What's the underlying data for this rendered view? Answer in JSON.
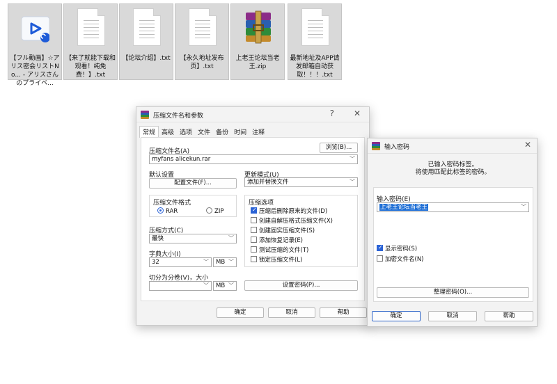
{
  "desktop": {
    "files": [
      {
        "name": "【フル動画】☆アリス密会リストNo... - アリスさんのプライベ...",
        "icon": "video-shortcut-icon"
      },
      {
        "name": "【来了就能下载和观看！纯免费！】.txt",
        "icon": "text-file-icon"
      },
      {
        "name": "【论坛介绍】.txt",
        "icon": "text-file-icon"
      },
      {
        "name": "【永久地址发布页】.txt",
        "icon": "text-file-icon"
      },
      {
        "name": "上老王论坛当老王.zip",
        "icon": "winrar-archive-icon"
      },
      {
        "name": "最新地址及APP请发邮箱自动获取！！！.txt",
        "icon": "text-file-icon"
      }
    ]
  },
  "archive_dialog": {
    "title": "压缩文件名和参数",
    "help_glyph": "?",
    "close_glyph": "✕",
    "tabs": [
      "常规",
      "高级",
      "选项",
      "文件",
      "备份",
      "时间",
      "注释"
    ],
    "archive_name_label": "压缩文件名(A)",
    "browse_label": "浏览(B)...",
    "archive_name_value": "myfans alicekun.rar",
    "default_settings_label": "默认设置",
    "profiles_label": "配置文件(F)...",
    "update_mode_label": "更新模式(U)",
    "update_mode_value": "添加并替换文件",
    "format_label": "压缩文件格式",
    "format_rar": "RAR",
    "format_zip": "ZIP",
    "options_label": "压缩选项",
    "options": [
      {
        "label": "压缩后删除原来的文件(D)",
        "checked": true
      },
      {
        "label": "创建自解压格式压缩文件(X)",
        "checked": false
      },
      {
        "label": "创建固实压缩文件(S)",
        "checked": false
      },
      {
        "label": "添加恢复记录(E)",
        "checked": false
      },
      {
        "label": "测试压缩的文件(T)",
        "checked": false
      },
      {
        "label": "锁定压缩文件(L)",
        "checked": false
      }
    ],
    "method_label": "压缩方式(C)",
    "method_value": "最快",
    "dict_label": "字典大小(I)",
    "dict_value": "32",
    "dict_unit": "MB",
    "split_label": "切分为分卷(V)，大小",
    "split_value": "",
    "split_unit": "MB",
    "set_password_label": "设置密码(P)...",
    "ok_label": "确定",
    "cancel_label": "取消",
    "help_label": "帮助"
  },
  "password_dialog": {
    "title": "输入密码",
    "close_glyph": "✕",
    "info_line1": "已输入密码标签。",
    "info_line2": "将使用匹配此标签的密码。",
    "password_label": "输入密码(E)",
    "password_value": "上老王论坛当老王",
    "show_password_label": "显示密码(S)",
    "show_password_checked": true,
    "encrypt_names_label": "加密文件名(N)",
    "encrypt_names_checked": false,
    "organize_label": "整理密码(O)...",
    "ok_label": "确定",
    "cancel_label": "取消",
    "help_label": "帮助"
  },
  "colors": {
    "accent": "#2b63d6",
    "selection": "#1f6fd6",
    "desktop_tile": "#d9d9d9"
  }
}
